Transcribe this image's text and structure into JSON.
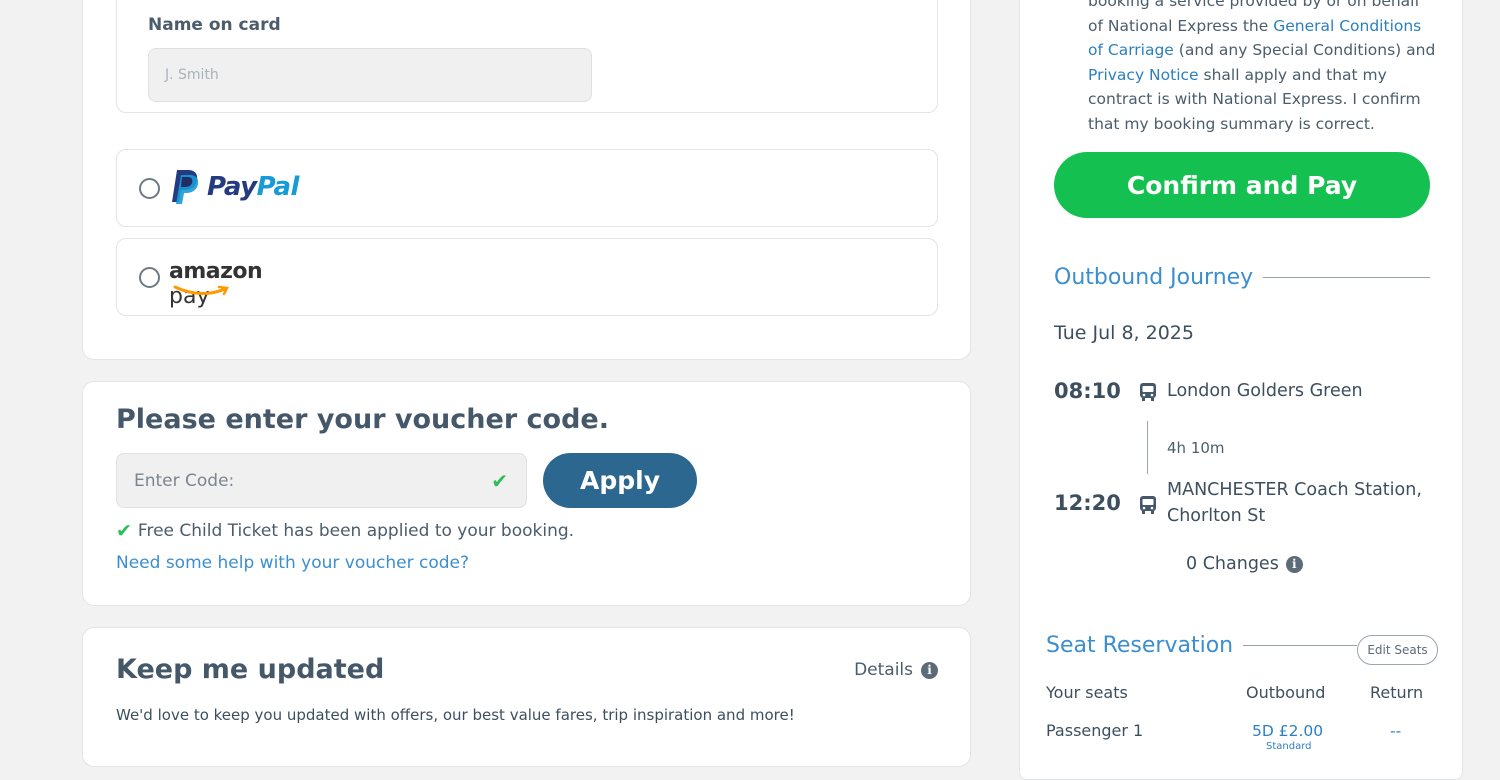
{
  "payment": {
    "name_label": "Name on card",
    "name_placeholder": "J. Smith",
    "paypal": {
      "pay": "Pay",
      "pal": "Pal"
    },
    "amazon": {
      "word": "amazon",
      "pay": "pay"
    }
  },
  "voucher": {
    "title": "Please enter your voucher code.",
    "placeholder": "Enter Code:",
    "apply_label": "Apply",
    "applied_message": "Free Child Ticket has been applied to your booking.",
    "help_link": "Need some help with your voucher code?"
  },
  "updates": {
    "title": "Keep me updated",
    "details_label": "Details",
    "description": "We'd love to keep you updated with offers, our best value fares, trip inspiration and more!"
  },
  "summary": {
    "terms_prefix": "booking a service provided by or on behalf of National Express the ",
    "terms_link1": "General Conditions of Carriage",
    "terms_mid": " (and any Special Conditions) and ",
    "terms_link2": "Privacy Notice",
    "terms_suffix": " shall apply and that my contract is with National Express. I confirm that my booking summary is correct.",
    "confirm_label": "Confirm and Pay",
    "outbound_title": "Outbound Journey",
    "date": "Tue Jul 8, 2025",
    "depart_time": "08:10",
    "depart_stop": "London Golders Green",
    "duration": "4h 10m",
    "arrive_time": "12:20",
    "arrive_stop": "MANCHESTER Coach Station, Chorlton St",
    "changes": "0 Changes",
    "seat_title": "Seat Reservation",
    "edit_seats": "Edit Seats",
    "col_your_seats": "Your seats",
    "col_outbound": "Outbound",
    "col_return": "Return",
    "passenger": "Passenger 1",
    "outbound_seat": "5D £2.00",
    "outbound_seat_type": "Standard",
    "return_seat": "--"
  },
  "colors": {
    "accent": "#3b8ed0",
    "confirm": "#14c050",
    "apply": "#2c6790"
  }
}
